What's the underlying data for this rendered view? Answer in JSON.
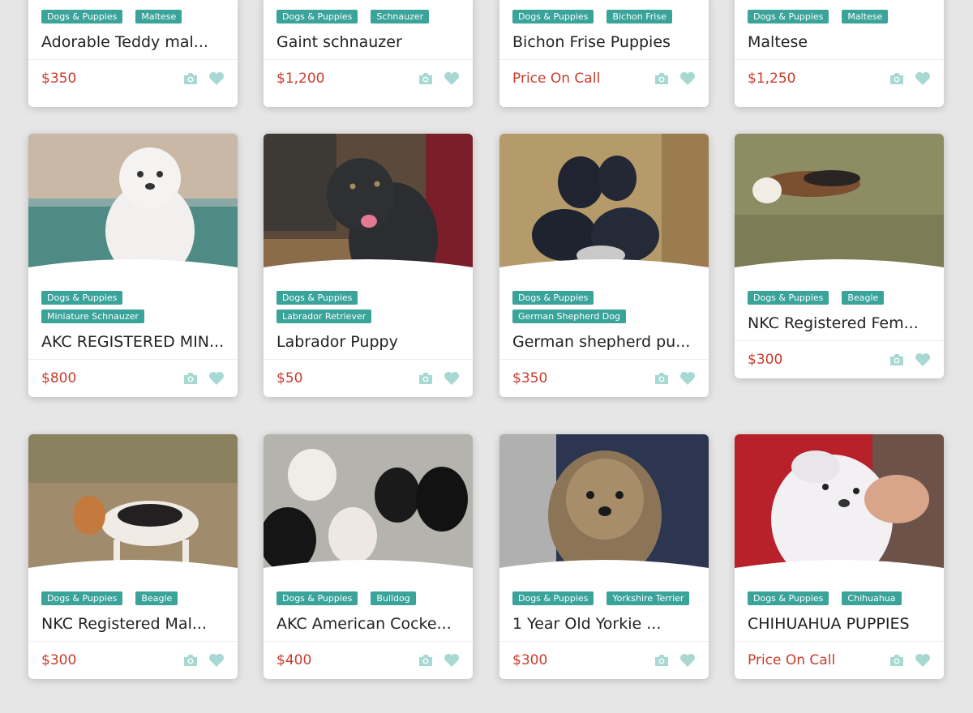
{
  "colors": {
    "tag_bg": "#3aa39a",
    "price": "#c93b2c",
    "icon": "#a8d8d3",
    "background": "#e6e6e6"
  },
  "icons": {
    "camera": "camera-icon",
    "favorite": "heart-icon"
  },
  "listings": [
    {
      "tags": [
        "Dogs & Puppies",
        "Maltese"
      ],
      "title": "Adorable Teddy mal...",
      "price": "$350"
    },
    {
      "tags": [
        "Dogs & Puppies",
        "Schnauzer"
      ],
      "title": "Gaint schnauzer",
      "price": "$1,200"
    },
    {
      "tags": [
        "Dogs & Puppies",
        "Bichon Frise"
      ],
      "title": "Bichon Frise Puppies",
      "price": "Price On Call"
    },
    {
      "tags": [
        "Dogs & Puppies",
        "Maltese"
      ],
      "title": "Maltese",
      "price": "$1,250"
    },
    {
      "tags": [
        "Dogs & Puppies",
        "Miniature Schnauzer"
      ],
      "title": "AKC REGISTERED MIN...",
      "price": "$800"
    },
    {
      "tags": [
        "Dogs & Puppies",
        "Labrador Retriever"
      ],
      "title": "Labrador Puppy",
      "price": "$50"
    },
    {
      "tags": [
        "Dogs & Puppies",
        "German Shepherd Dog"
      ],
      "title": "German shepherd pu...",
      "price": "$350"
    },
    {
      "tags": [
        "Dogs & Puppies",
        "Beagle"
      ],
      "title": "NKC Registered Fem...",
      "price": "$300"
    },
    {
      "tags": [
        "Dogs & Puppies",
        "Beagle"
      ],
      "title": "NKC Registered Mal...",
      "price": "$300"
    },
    {
      "tags": [
        "Dogs & Puppies",
        "Bulldog"
      ],
      "title": "AKC American Cocke...",
      "price": "$400"
    },
    {
      "tags": [
        "Dogs & Puppies",
        "Yorkshire Terrier"
      ],
      "title": "1 Year Old Yorkie ...",
      "price": "$300"
    },
    {
      "tags": [
        "Dogs & Puppies",
        "Chihuahua"
      ],
      "title": "CHIHUAHUA PUPPIES",
      "price": "Price On Call"
    }
  ]
}
